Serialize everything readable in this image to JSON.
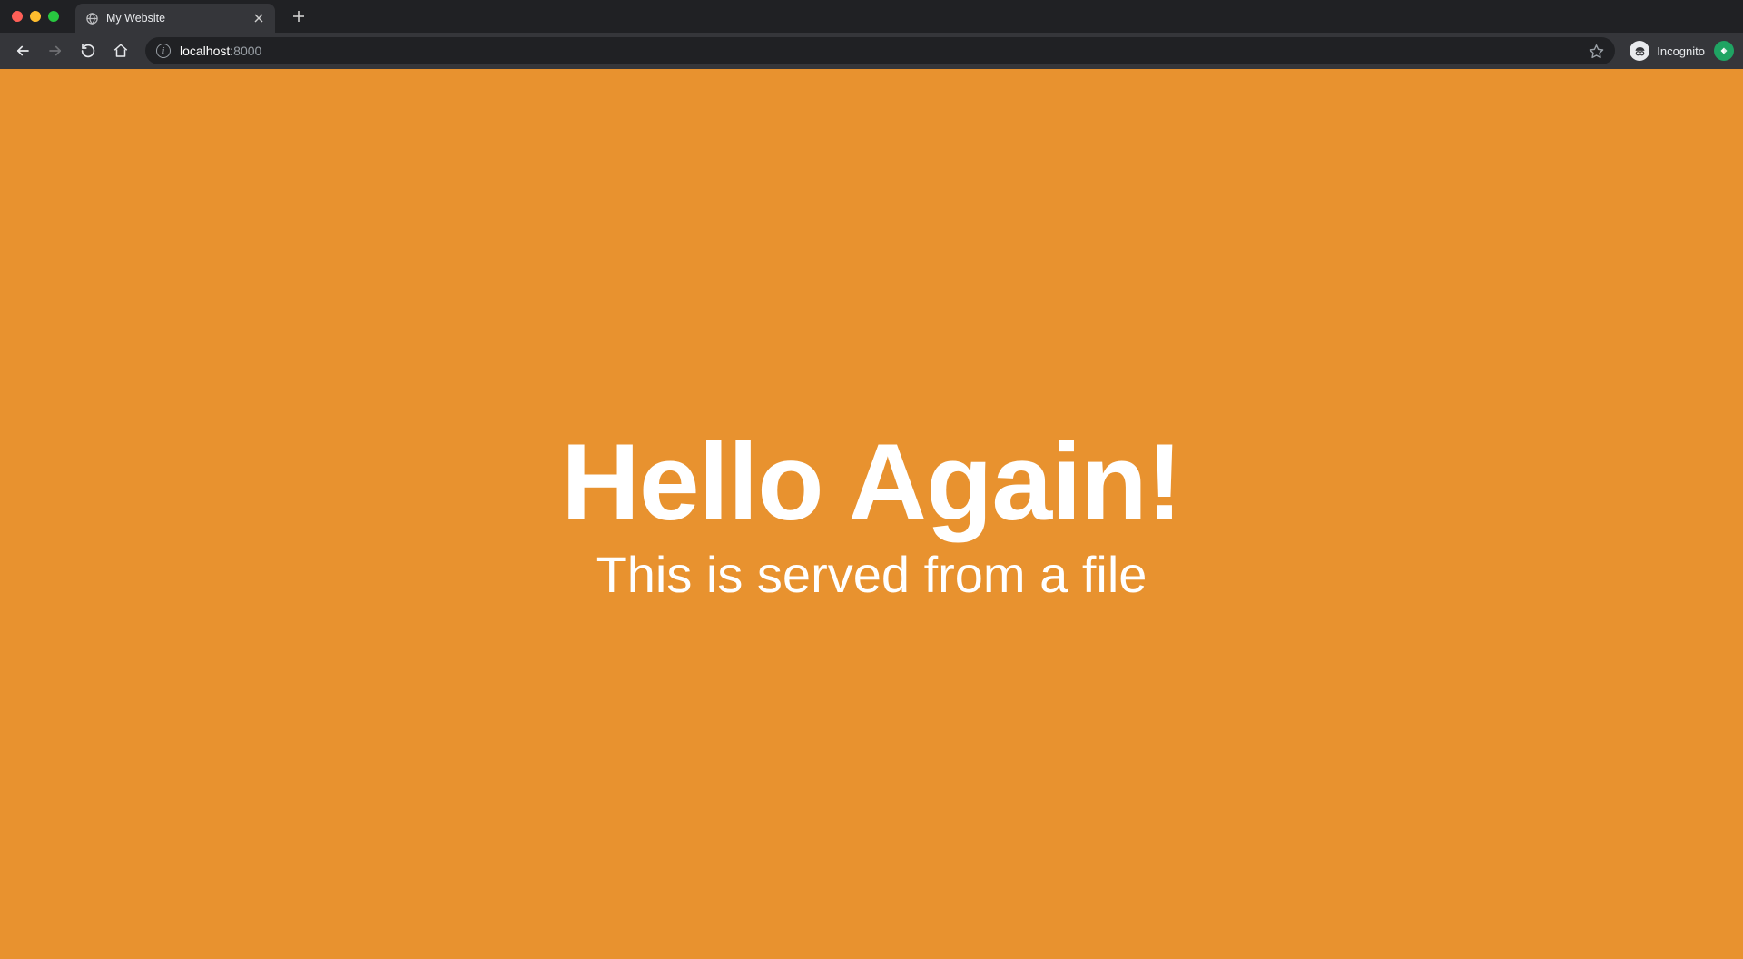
{
  "window": {
    "traffic": {
      "close": "#ff5f57",
      "min": "#ffbd2e",
      "max": "#28c840"
    }
  },
  "tabs": {
    "active": {
      "favicon": "globe-icon",
      "title": "My Website"
    }
  },
  "toolbar": {
    "back_enabled": true,
    "forward_enabled": false
  },
  "address_bar": {
    "security_icon": "info-icon",
    "host": "localhost",
    "port": ":8000"
  },
  "chrome_right": {
    "incognito_label": "Incognito"
  },
  "page": {
    "background": "#e8922f",
    "heading": "Hello Again!",
    "subheading": "This is served from a file"
  }
}
